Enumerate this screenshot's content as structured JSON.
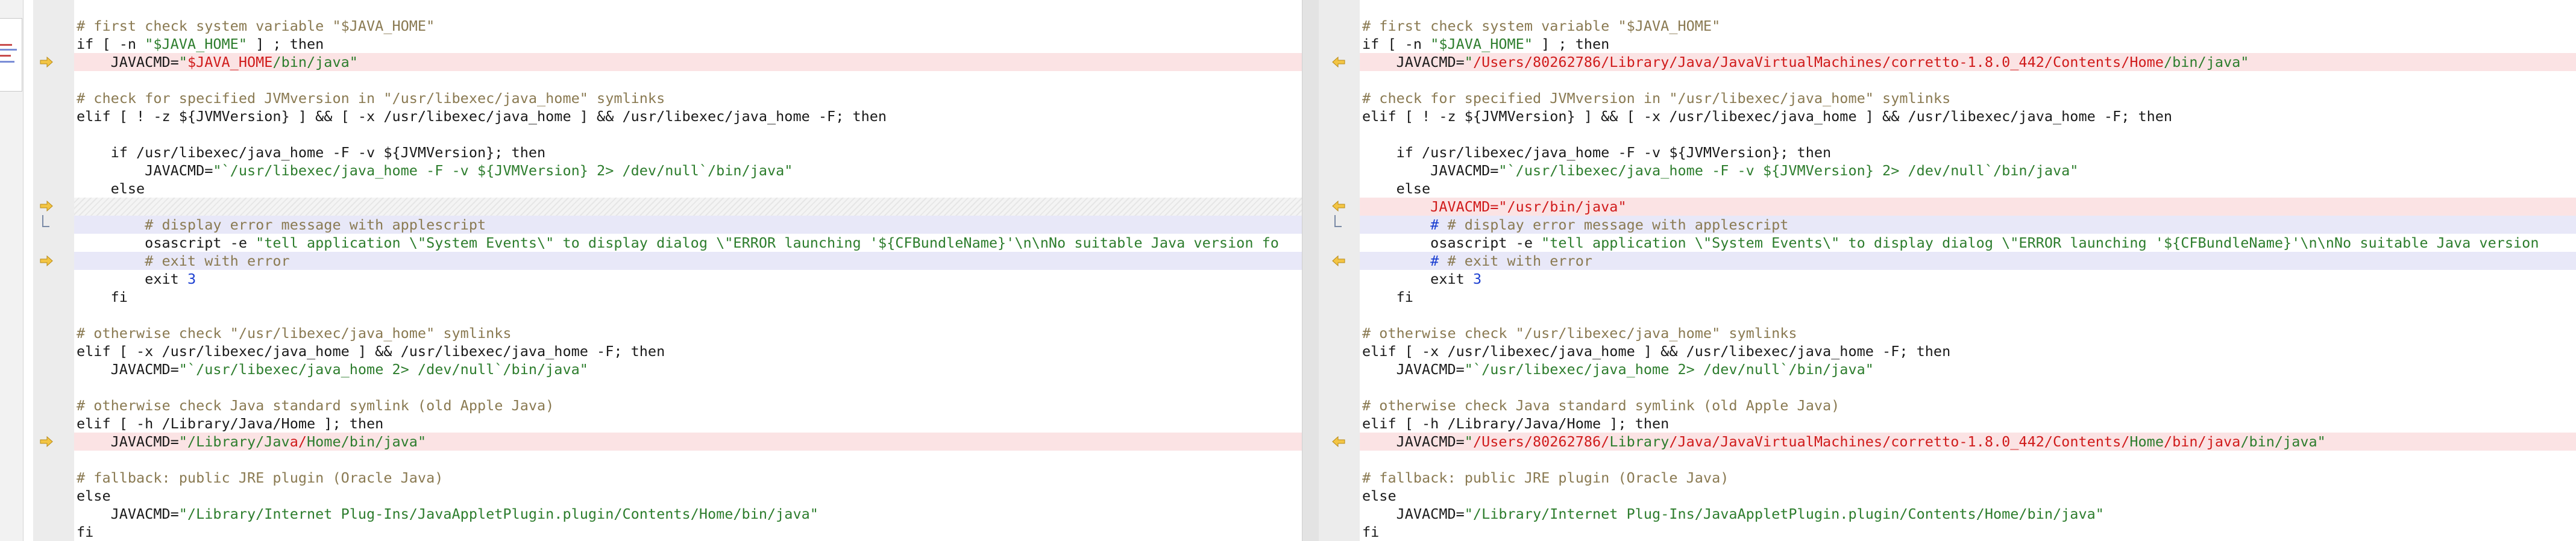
{
  "colors": {
    "change_bg": "#fbe3e4",
    "edit_bg": "#e8e8f8",
    "comment": "#8a7a52",
    "string": "#2d7d2d",
    "removed_text": "#d01b1b",
    "number": "#1b3fd1",
    "arrow": "#e2ad2c"
  },
  "icons": {
    "copy_right": "arrow-right-icon",
    "copy_left": "arrow-left-icon"
  },
  "left": {
    "l1": "# first check system variable \"$JAVA_HOME\"",
    "l2a": "if [ -n ",
    "l2b": "\"$JAVA_HOME\"",
    "l2c": " ] ; then",
    "l3a": "    JAVACMD=",
    "l3b": "\"",
    "l3c": "$JAVA_HOME",
    "l3d": "/bin/java\"",
    "l5": "# check for specified JVMversion in \"/usr/libexec/java_home\" symlinks",
    "l6": "elif [ ! -z ${JVMVersion} ] && [ -x /usr/libexec/java_home ] && /usr/libexec/java_home -F; then",
    "l8": "    if /usr/libexec/java_home -F -v ${JVMVersion}; then",
    "l9a": "        JAVACMD=",
    "l9b": "\"`/usr/libexec/java_home -F -v ${JVMVersion} 2> /dev/null`/bin/java\"",
    "l10": "    else",
    "l12": "        # display error message with applescript",
    "l13a": "        osascript -e ",
    "l13b": "\"tell application \\\"System Events\\\" to display dialog \\\"ERROR launching '${CFBundleName}'\\n\\nNo suitable Java version fo",
    "l14": "        # exit with error",
    "l15a": "        exit ",
    "l15b": "3",
    "l16": "    fi",
    "l18": "# otherwise check \"/usr/libexec/java_home\" symlinks",
    "l19": "elif [ -x /usr/libexec/java_home ] && /usr/libexec/java_home -F; then",
    "l20a": "    JAVACMD=",
    "l20b": "\"`/usr/libexec/java_home 2> /dev/null`/bin/java\"",
    "l22": "# otherwise check Java standard symlink (old Apple Java)",
    "l23": "elif [ -h /Library/Java/Home ]; then",
    "l24a": "    JAVACMD=",
    "l24b": "\"/Library/Jav",
    "l24c": "a/",
    "l24d": "Home/bin/java\"",
    "l26": "# fallback: public JRE plugin (Oracle Java)",
    "l27": "else",
    "l28a": "    JAVACMD=",
    "l28b": "\"/Library/Internet Plug-Ins/JavaAppletPlugin.plugin/Contents/Home/bin/java\"",
    "l29": "fi"
  },
  "right": {
    "l1": "# first check system variable \"$JAVA_HOME\"",
    "l2a": "if [ -n ",
    "l2b": "\"$JAVA_HOME\"",
    "l2c": " ] ; then",
    "l3a": "    JAVACMD=",
    "l3b": "\"",
    "l3c": "/Users/80262786/Library/Java/JavaVirtualMachines/corretto-1.8.0_442/Contents/Home",
    "l3d": "/bin/java\"",
    "l5": "# check for specified JVMversion in \"/usr/libexec/java_home\" symlinks",
    "l6": "elif [ ! -z ${JVMVersion} ] && [ -x /usr/libexec/java_home ] && /usr/libexec/java_home -F; then",
    "l8": "    if /usr/libexec/java_home -F -v ${JVMVersion}; then",
    "l9a": "        JAVACMD=",
    "l9b": "\"`/usr/libexec/java_home -F -v ${JVMVersion} 2> /dev/null`/bin/java\"",
    "l10": "    else",
    "l11": "        JAVACMD=\"/usr/bin/java\"",
    "l12a": "        # ",
    "l12b": "# display error message with applescript",
    "l13a": "        osascript -e ",
    "l13b": "\"tell application \\\"System Events\\\" to display dialog \\\"ERROR launching '${CFBundleName}'\\n\\nNo suitable Java version",
    "l14a": "        # ",
    "l14b": "# exit with error",
    "l15a": "        exit ",
    "l15b": "3",
    "l16": "    fi",
    "l18": "# otherwise check \"/usr/libexec/java_home\" symlinks",
    "l19": "elif [ -x /usr/libexec/java_home ] && /usr/libexec/java_home -F; then",
    "l20a": "    JAVACMD=",
    "l20b": "\"`/usr/libexec/java_home 2> /dev/null`/bin/java\"",
    "l22": "# otherwise check Java standard symlink (old Apple Java)",
    "l23": "elif [ -h /Library/Java/Home ]; then",
    "l24a": "    JAVACMD=",
    "l24b": "\"",
    "l24c": "/Users/80262786/",
    "l24d": "Library",
    "l24e": "/Java/",
    "l24f": "JavaVirtualMachines/corretto-1.8.0_442/Contents/",
    "l24g": "Home",
    "l24h": "/bin/java",
    "l24i": "/bin/java\"",
    "l26": "# fallback: public JRE plugin (Oracle Java)",
    "l27": "else",
    "l28a": "    JAVACMD=",
    "l28b": "\"/Library/Internet Plug-Ins/JavaAppletPlugin.plugin/Contents/Home/bin/java\"",
    "l29": "fi"
  }
}
